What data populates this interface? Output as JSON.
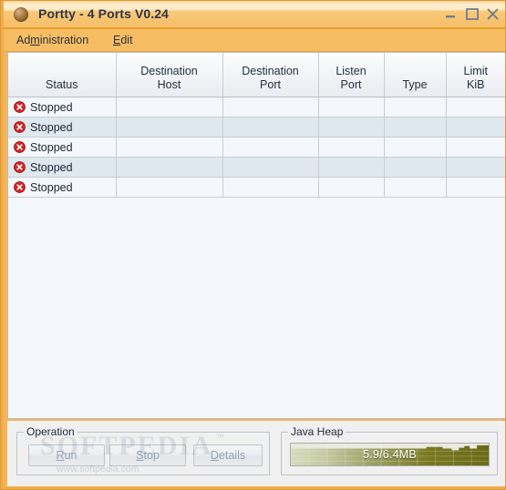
{
  "window": {
    "title": "Portty - 4 Ports V0.24",
    "icon": "app-sphere-icon",
    "controls": {
      "minimize": "minimize-icon",
      "maximize": "maximize-icon",
      "close": "close-icon"
    },
    "frame_color": "#f0ad4a",
    "titlebar_color": "#f6bf6a"
  },
  "menubar": {
    "items": [
      {
        "label": "Administration",
        "mnemonic": "m"
      },
      {
        "label": "Edit",
        "mnemonic": "E"
      }
    ]
  },
  "table": {
    "columns": [
      {
        "label_line1": "",
        "label_line2": "Status"
      },
      {
        "label_line1": "Destination",
        "label_line2": "Host"
      },
      {
        "label_line1": "Destination",
        "label_line2": "Port"
      },
      {
        "label_line1": "Listen",
        "label_line2": "Port"
      },
      {
        "label_line1": "",
        "label_line2": "Type"
      },
      {
        "label_line1": "Limit",
        "label_line2": "KiB"
      }
    ],
    "rows": [
      {
        "status": "Stopped",
        "status_icon": "error-circle-icon",
        "destination_host": "",
        "destination_port": "",
        "listen_port": "",
        "type": "",
        "limit_kib": ""
      },
      {
        "status": "Stopped",
        "status_icon": "error-circle-icon",
        "destination_host": "",
        "destination_port": "",
        "listen_port": "",
        "type": "",
        "limit_kib": ""
      },
      {
        "status": "Stopped",
        "status_icon": "error-circle-icon",
        "destination_host": "",
        "destination_port": "",
        "listen_port": "",
        "type": "",
        "limit_kib": ""
      },
      {
        "status": "Stopped",
        "status_icon": "error-circle-icon",
        "destination_host": "",
        "destination_port": "",
        "listen_port": "",
        "type": "",
        "limit_kib": ""
      },
      {
        "status": "Stopped",
        "status_icon": "error-circle-icon",
        "destination_host": "",
        "destination_port": "",
        "listen_port": "",
        "type": "",
        "limit_kib": ""
      }
    ],
    "status_icon_color": "#d32525"
  },
  "operation": {
    "title": "Operation",
    "buttons": [
      {
        "label": "Run",
        "mnemonic": "R",
        "enabled": false
      },
      {
        "label": "Stop",
        "mnemonic": "S",
        "enabled": false
      },
      {
        "label": "Details",
        "mnemonic": "D",
        "enabled": false
      }
    ]
  },
  "java_heap": {
    "title": "Java Heap",
    "value_text": "5.9/6.4MB",
    "used_mb": 5.9,
    "total_mb": 6.4,
    "fill_color": "#6b6b18"
  },
  "watermark": {
    "main": "SOFTPEDIA",
    "tm": "™",
    "sub": "www.softpedia.com"
  }
}
